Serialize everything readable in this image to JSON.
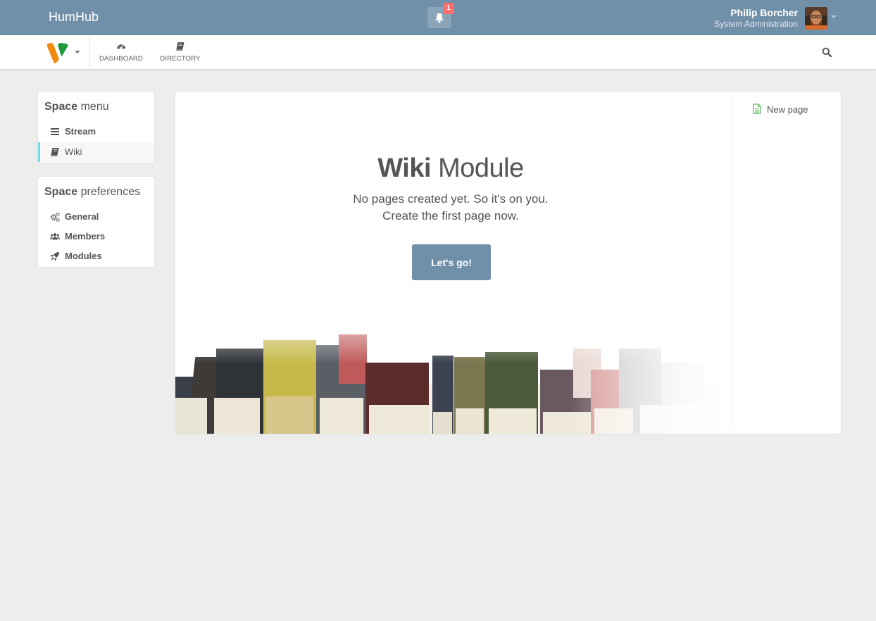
{
  "topbar": {
    "brand": "HumHub",
    "notifications": {
      "count": "1",
      "icon": "bell-icon"
    },
    "user": {
      "name": "Philip Borcher",
      "role": "System Administration"
    }
  },
  "nav": {
    "items": [
      {
        "label": "DASHBOARD",
        "icon": "dashboard-icon"
      },
      {
        "label": "DIRECTORY",
        "icon": "book-icon"
      }
    ],
    "search_icon": "search-icon"
  },
  "space_menu": {
    "title_bold": "Space",
    "title_rest": "menu",
    "items": [
      {
        "label": "Stream",
        "icon": "bars-icon"
      },
      {
        "label": "Wiki",
        "icon": "book-icon",
        "active": true
      }
    ]
  },
  "space_preferences": {
    "title_bold": "Space",
    "title_rest": "preferences",
    "items": [
      {
        "label": "General",
        "icon": "cogs-icon"
      },
      {
        "label": "Members",
        "icon": "group-icon"
      },
      {
        "label": "Modules",
        "icon": "rocket-icon"
      }
    ]
  },
  "wiki": {
    "title_bold": "Wiki",
    "title_rest": "Module",
    "line1": "No pages created yet. So it's on you.",
    "line2": "Create the first page now.",
    "button": "Let's go!"
  },
  "sidebar": {
    "new_page": "New page",
    "icon": "file-icon"
  },
  "colors": {
    "topbar": "#708fa9",
    "accent": "#6fdbe8",
    "badge": "#fc6e6e",
    "new_page_icon": "#5cb85c"
  }
}
